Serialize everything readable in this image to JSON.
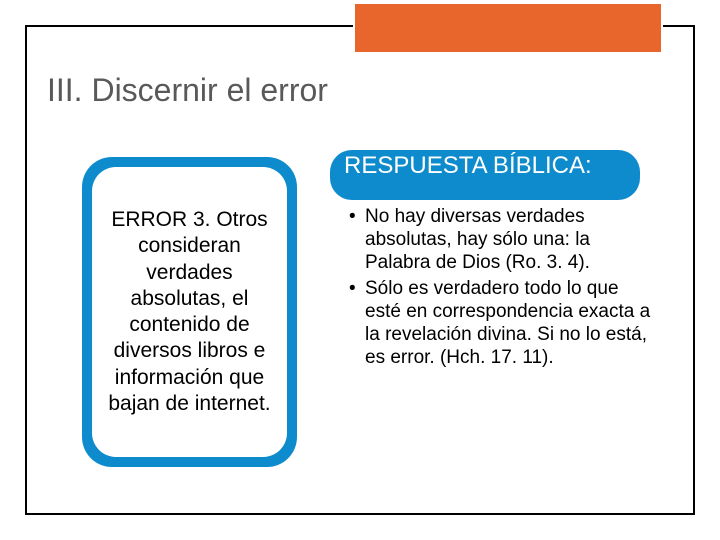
{
  "title": "III. Discernir el error",
  "left_card": {
    "text": "ERROR 3. Otros consideran verdades absolutas, el contenido de diversos libros e información que bajan de internet."
  },
  "right": {
    "heading": "RESPUESTA BÍBLICA:",
    "bullets": [
      "No hay diversas verdades absolutas, hay sólo una: la Palabra de Dios (Ro. 3. 4).",
      "Sólo es verdadero todo lo que esté en correspondencia exacta a la revelación divina. Si no lo está, es error. (Hch. 17. 11)."
    ]
  }
}
